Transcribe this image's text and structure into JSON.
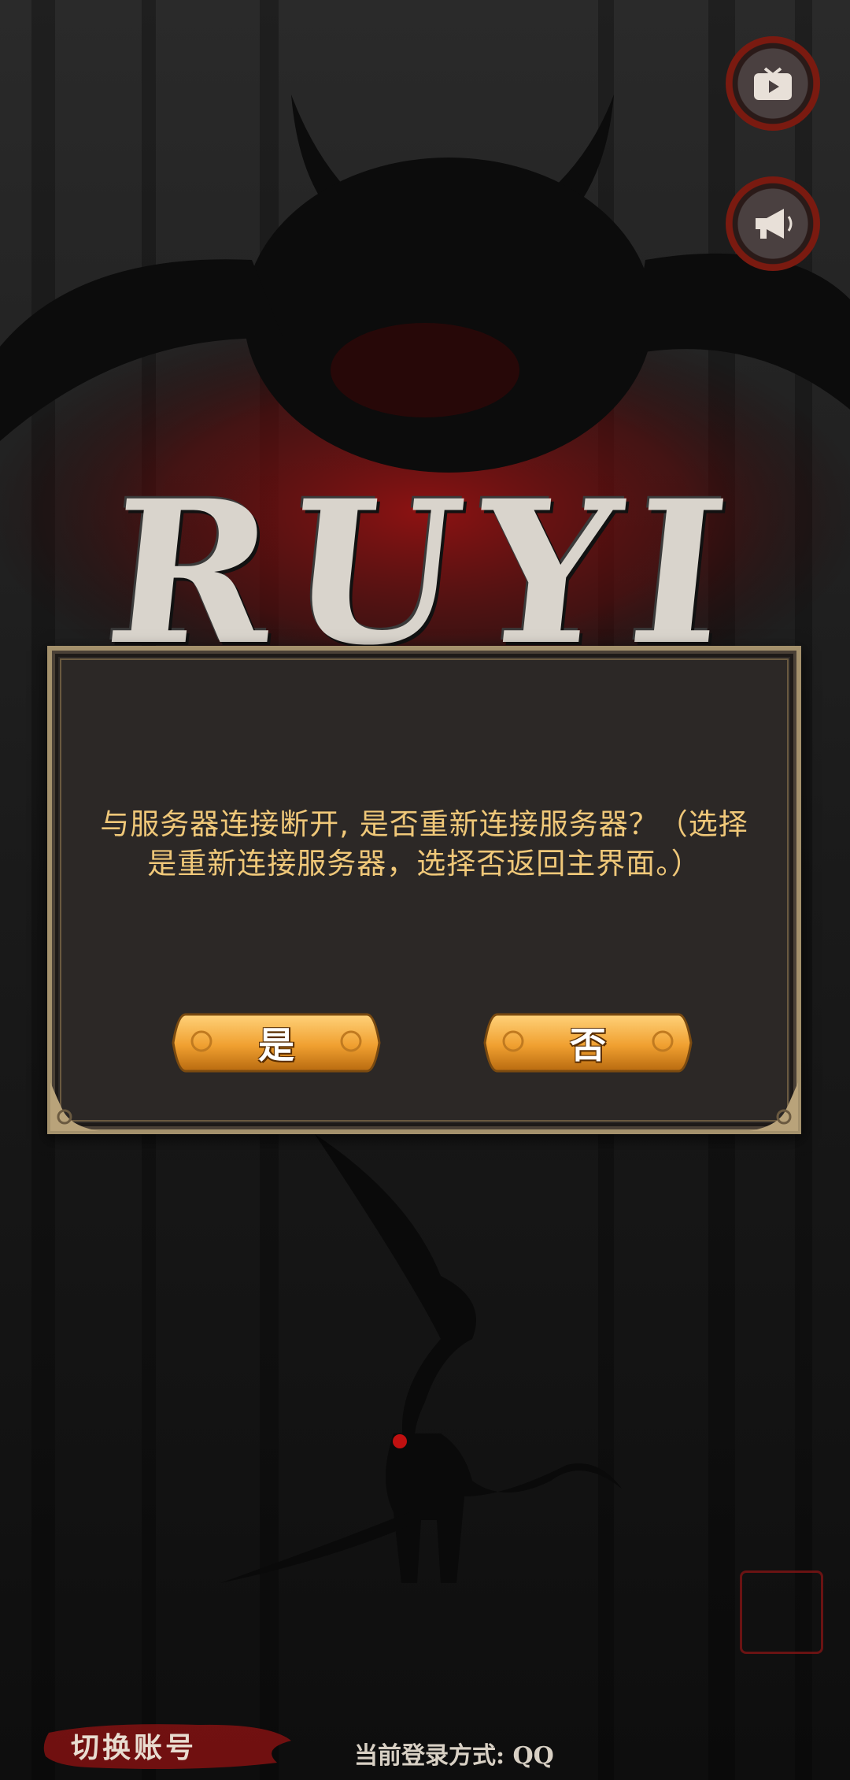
{
  "game": {
    "title": "RUYI"
  },
  "top_buttons": [
    {
      "name": "video",
      "icon": "video-icon"
    },
    {
      "name": "announcement",
      "icon": "megaphone-icon"
    }
  ],
  "dialog": {
    "message": "与服务器连接断开, 是否重新连接服务器？（选择是重新连接服务器，选择否返回主界面。）",
    "yes_label": "是",
    "no_label": "否"
  },
  "footer": {
    "switch_account_label": "切换账号",
    "login_method_label": "当前登录方式: QQ"
  },
  "colors": {
    "dialog_text": "#f0c879",
    "button_orange": "#f0a030",
    "accent_red": "#8a1212"
  }
}
